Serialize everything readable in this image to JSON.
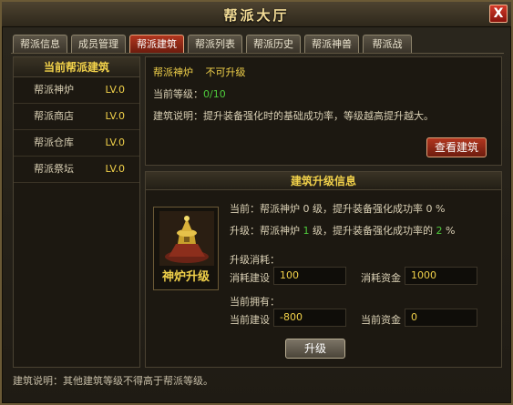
{
  "window": {
    "title": "帮派大厅",
    "close_glyph": "X"
  },
  "tabs": [
    {
      "label": "帮派信息",
      "active": false
    },
    {
      "label": "成员管理",
      "active": false
    },
    {
      "label": "帮派建筑",
      "active": true
    },
    {
      "label": "帮派列表",
      "active": false
    },
    {
      "label": "帮派历史",
      "active": false
    },
    {
      "label": "帮派神兽",
      "active": false
    },
    {
      "label": "帮派战",
      "active": false
    }
  ],
  "buildings": {
    "header": "当前帮派建筑",
    "items": [
      {
        "name": "帮派神炉",
        "level": "LV.0"
      },
      {
        "name": "帮派商店",
        "level": "LV.0"
      },
      {
        "name": "帮派仓库",
        "level": "LV.0"
      },
      {
        "name": "帮派祭坛",
        "level": "LV.0"
      }
    ]
  },
  "detail": {
    "name": "帮派神炉",
    "status": "不可升级",
    "level_label": "当前等级：",
    "level_value": "0/10",
    "desc_label": "建筑说明：",
    "desc_text": "提升装备强化时的基础成功率，等级越高提升越大。",
    "view_button": "查看建筑"
  },
  "upgrade": {
    "header": "建筑升级信息",
    "icon_caption": "神炉升级",
    "icon_name": "furnace-icon",
    "current_line": {
      "prefix": "当前：帮派神炉 ",
      "level": "0",
      "mid": " 级，提升装备强化成功率 ",
      "value": "0",
      "suffix": " %"
    },
    "next_line": {
      "prefix": "升级：帮派神炉 ",
      "level": "1",
      "mid": " 级，提升装备强化成功率的 ",
      "value": "2",
      "suffix": " %"
    },
    "cost_title": "升级消耗：",
    "cost_build_label": "消耗建设",
    "cost_build_value": "100",
    "cost_fund_label": "消耗资金",
    "cost_fund_value": "1000",
    "own_title": "当前拥有：",
    "own_build_label": "当前建设",
    "own_build_value": "-800",
    "own_fund_label": "当前资金",
    "own_fund_value": "0",
    "button": "升级"
  },
  "footer": {
    "note": "建筑说明：其他建筑等级不得高于帮派等级。"
  },
  "colors": {
    "accent": "#f1d14a",
    "green": "#4ecb3c",
    "tab_active": "#b2361f"
  }
}
